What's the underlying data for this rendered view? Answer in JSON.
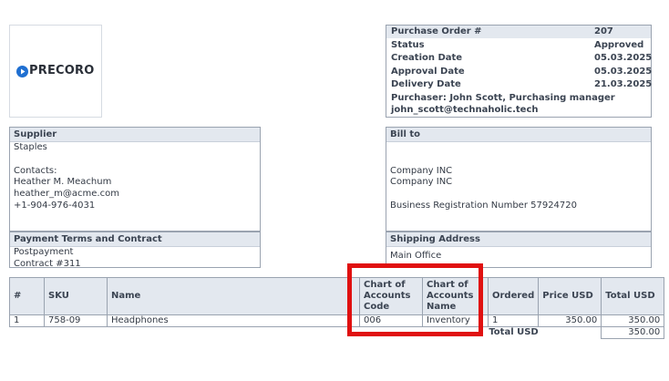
{
  "logo": {
    "text": "PRECORO",
    "color": "#1f6fd1"
  },
  "po": {
    "rows": [
      {
        "label": "Purchase Order #",
        "value": "207"
      },
      {
        "label": "Status",
        "value": "Approved"
      },
      {
        "label": "Creation Date",
        "value": "05.03.2025"
      },
      {
        "label": "Approval Date",
        "value": "05.03.2025"
      },
      {
        "label": "Delivery Date",
        "value": "21.03.2025"
      }
    ],
    "purchaser": "Purchaser: John Scott, Purchasing manager",
    "purchaser_email": "john_scott@technaholic.tech"
  },
  "supplier": {
    "title": "Supplier",
    "name": "Staples",
    "contacts_label": "Contacts:",
    "contact_name": "Heather M. Meachum",
    "contact_email": "heather_m@acme.com",
    "contact_phone": "+1-904-976-4031"
  },
  "payment": {
    "title": "Payment Terms and Contract",
    "terms": "Postpayment",
    "contract": "Contract #311"
  },
  "bill_to": {
    "title": "Bill to",
    "line1": "Company INC",
    "line2": "Company INC",
    "registration": "Business Registration Number 57924720"
  },
  "shipping": {
    "title": "Shipping Address",
    "address": "Main Office"
  },
  "table": {
    "headers": {
      "num": "#",
      "sku": "SKU",
      "name": "Name",
      "coa_code": "Chart of Accounts Code",
      "coa_name": "Chart of Accounts Name",
      "ordered": "Ordered",
      "price": "Price USD",
      "total": "Total USD"
    },
    "rows": [
      {
        "num": "1",
        "sku": "758-09",
        "name": "Headphones",
        "coa_code": "006",
        "coa_name": "Inventory",
        "ordered": "1",
        "price": "350.00",
        "total": "350.00"
      }
    ],
    "total_label": "Total USD",
    "total_value": "350.00"
  },
  "highlight_color": "#e01010"
}
